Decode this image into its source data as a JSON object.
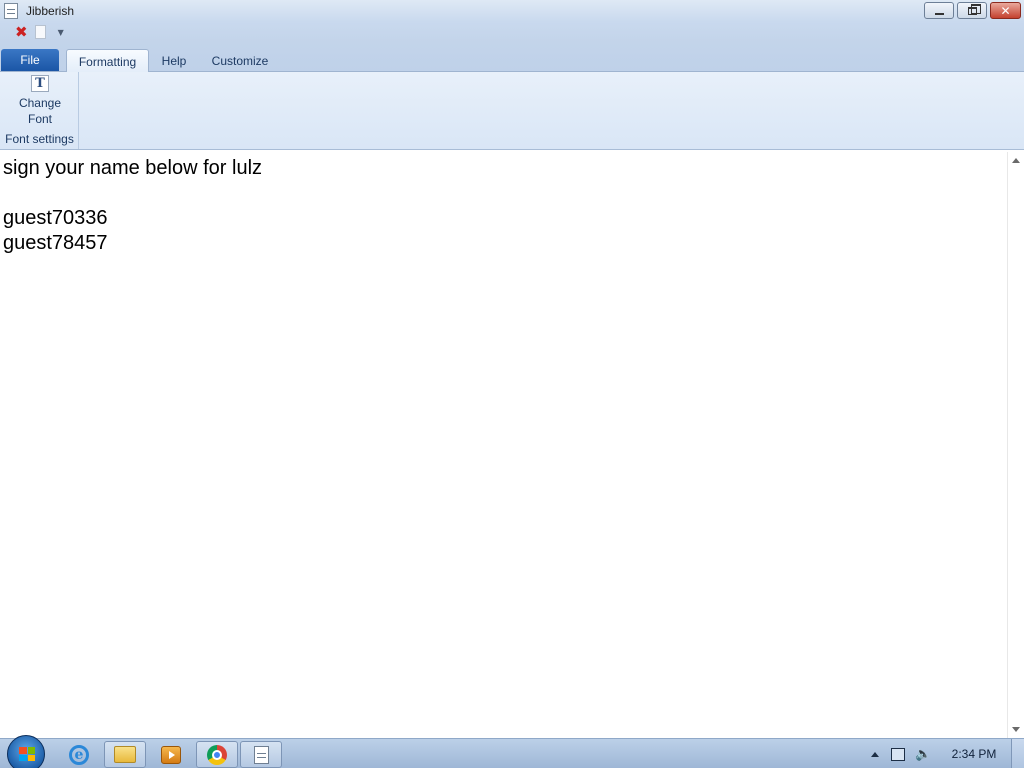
{
  "window": {
    "title": "Jibberish",
    "controls": {
      "minimize_icon": "minimize-icon",
      "maximize_icon": "restore-icon",
      "close_icon": "close-icon"
    }
  },
  "quick_access": {
    "icons": [
      "close-document-icon",
      "new-document-icon",
      "customize-dropdown-icon"
    ],
    "close_glyph": "✖"
  },
  "ribbon": {
    "file_tab": "File",
    "tabs": [
      {
        "label": "Formatting",
        "active": true
      },
      {
        "label": "Help",
        "active": false
      },
      {
        "label": "Customize",
        "active": false
      }
    ],
    "groups": [
      {
        "label": "Font settings",
        "buttons": [
          {
            "label_line1": "Change",
            "label_line2": "Font",
            "icon": "font-icon",
            "icon_glyph": "T"
          }
        ]
      }
    ]
  },
  "document": {
    "lines": [
      "sign your name below for lulz",
      "",
      "guest70336",
      "guest78457"
    ]
  },
  "taskbar": {
    "pinned": [
      {
        "name": "internet-explorer",
        "icon": "internet-explorer-icon",
        "glyph": "e",
        "open": false
      },
      {
        "name": "windows-explorer",
        "icon": "folder-icon",
        "open": true
      },
      {
        "name": "media-player",
        "icon": "media-player-icon",
        "open": false
      },
      {
        "name": "chrome",
        "icon": "chrome-icon",
        "open": true
      },
      {
        "name": "jibberish-app",
        "icon": "document-icon",
        "open": true
      }
    ],
    "tray": {
      "icons": [
        "show-hidden-icons-arrow-icon",
        "network-icon",
        "volume-icon"
      ],
      "volume_glyph": "🔈"
    },
    "clock": "2:34 PM"
  },
  "colors": {
    "file_tab": "#1b56a6",
    "ribbon_bg": "#dfe9f6",
    "close_button": "#c4412f"
  }
}
